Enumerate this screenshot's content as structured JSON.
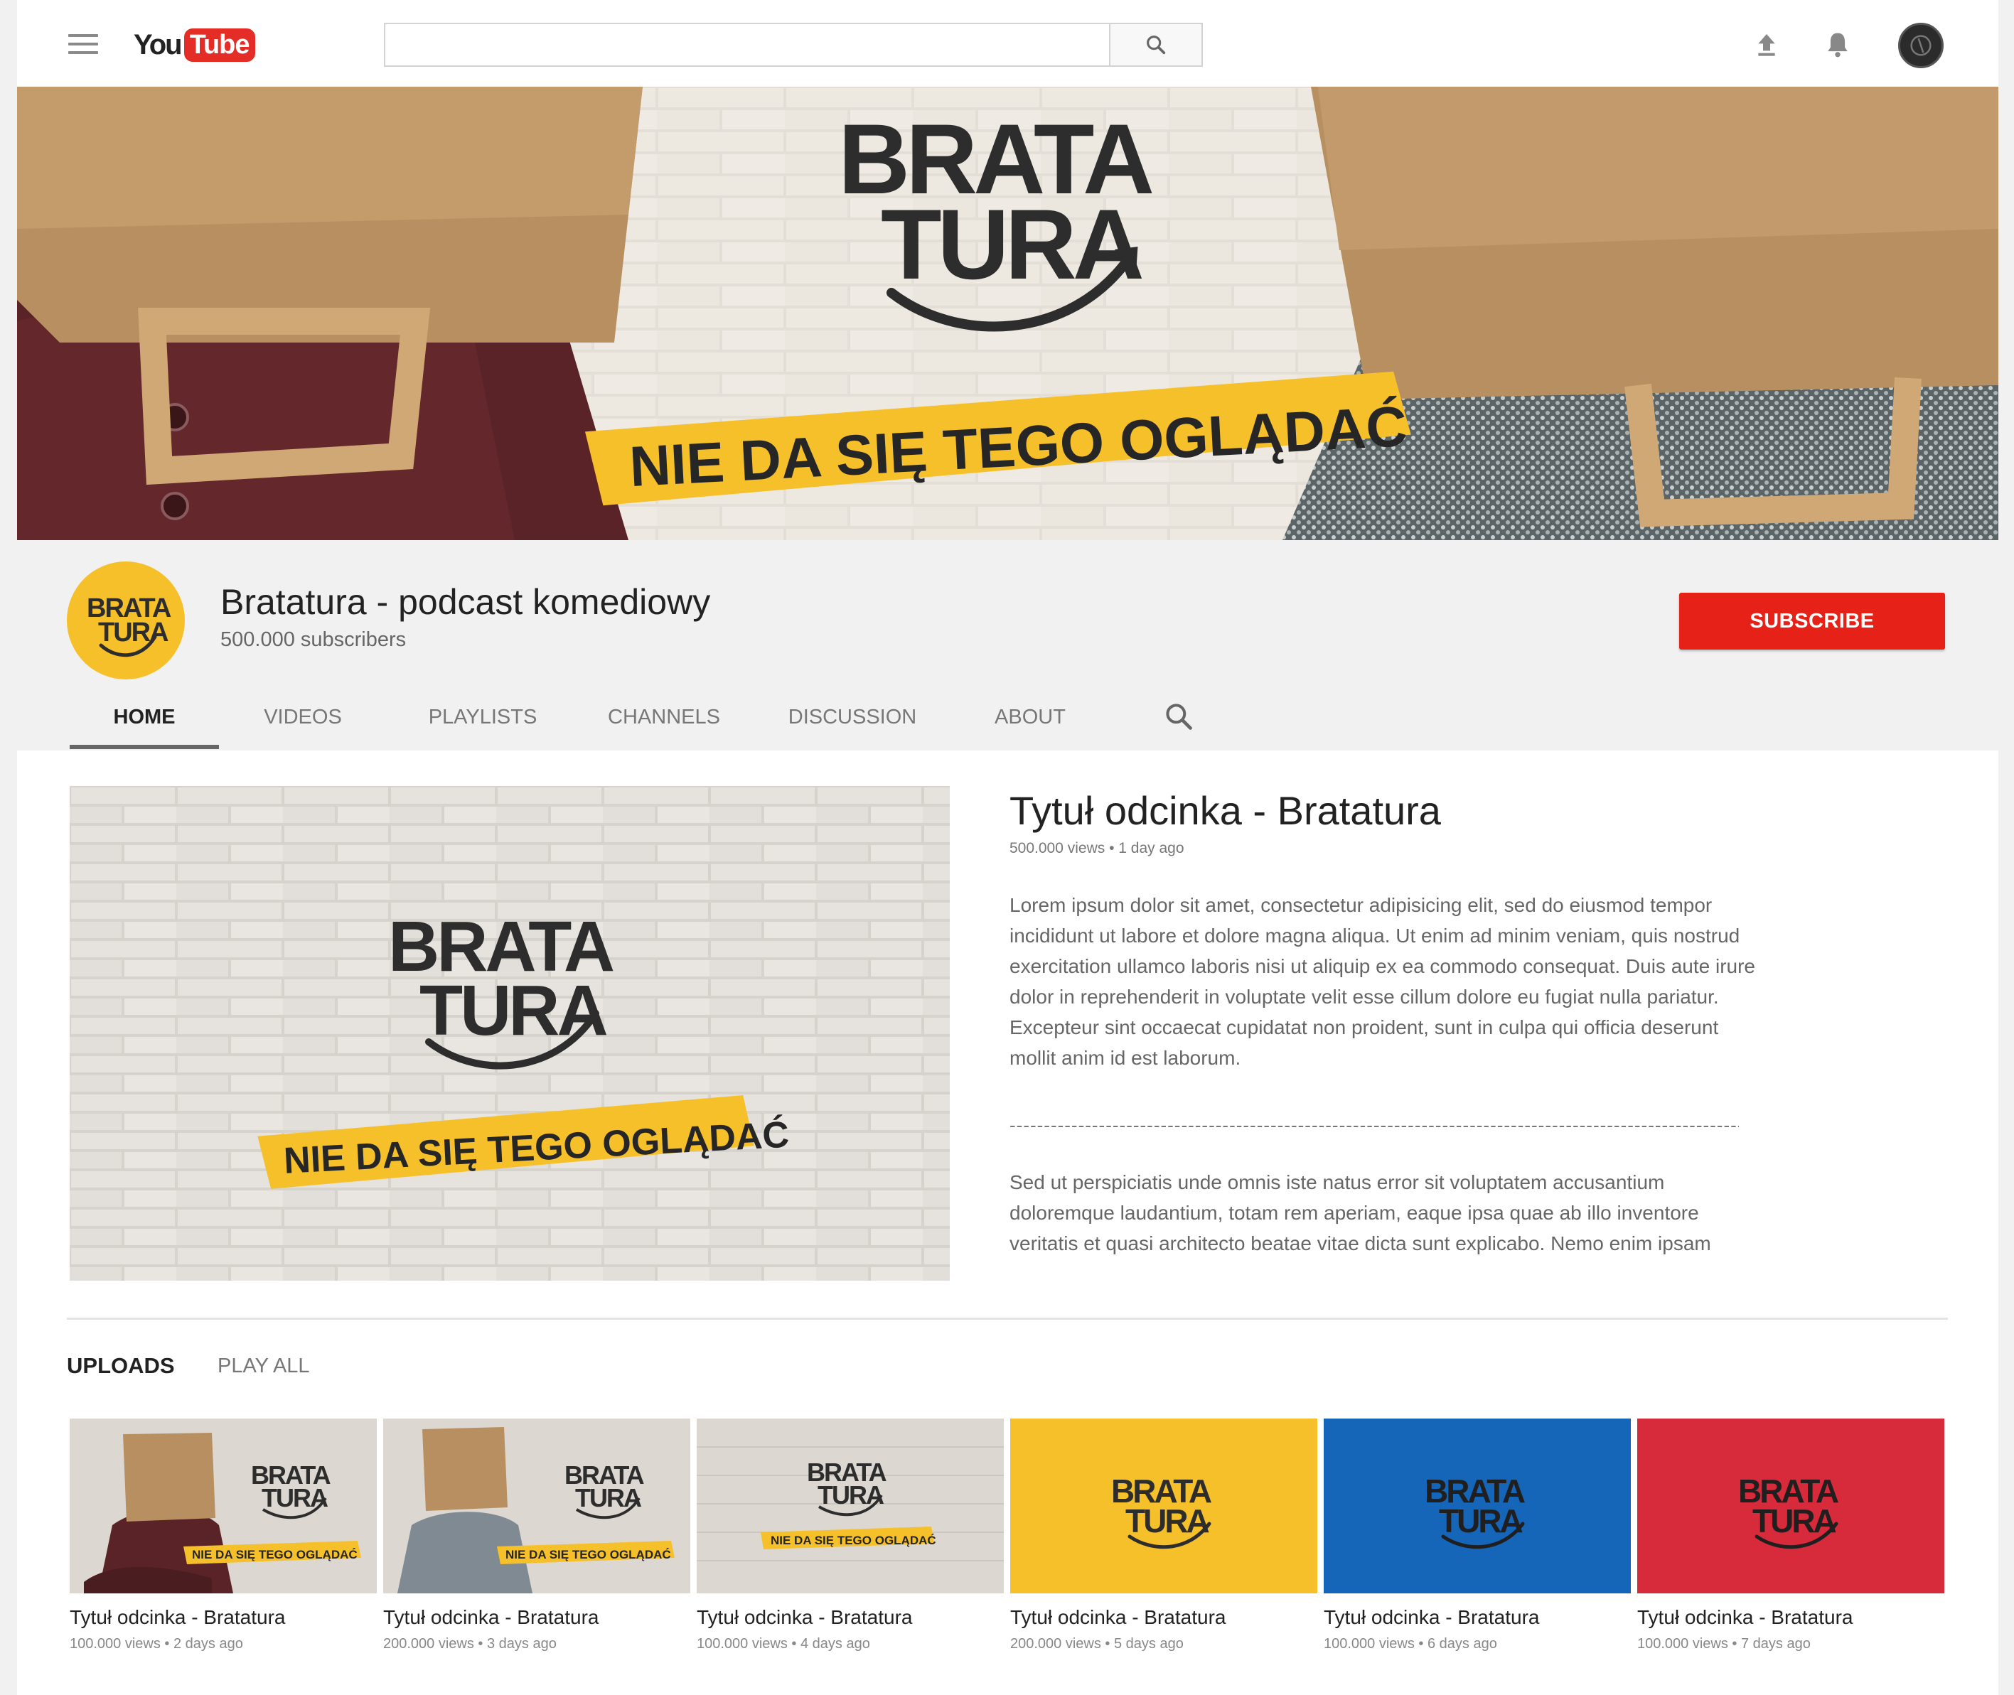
{
  "topbar": {
    "logo_you": "You",
    "logo_tube": "Tube",
    "search_placeholder": ""
  },
  "banner": {
    "logo_line1": "BRATA",
    "logo_line2": "TURA",
    "tagline": "NIE DA SIĘ TEGO OGLĄDAĆ"
  },
  "channel": {
    "title": "Bratatura - podcast komediowy",
    "subscribers": "500.000 subscribers",
    "subscribe_label": "SUBSCRIBE",
    "avatar_line1": "BRATA",
    "avatar_line2": "TURA"
  },
  "tabs": [
    {
      "label": "HOME",
      "active": true
    },
    {
      "label": "VIDEOS",
      "active": false
    },
    {
      "label": "PLAYLISTS",
      "active": false
    },
    {
      "label": "CHANNELS",
      "active": false
    },
    {
      "label": "DISCUSSION",
      "active": false
    },
    {
      "label": "ABOUT",
      "active": false
    }
  ],
  "featured": {
    "title": "Tytuł odcinka - Bratatura",
    "meta": "500.000 views • 1 day ago",
    "description": "Lorem ipsum dolor sit amet, consectetur adipisicing elit, sed do eiusmod tempor incididunt ut labore et dolore magna aliqua. Ut enim ad minim veniam, quis nostrud exercitation ullamco laboris nisi ut aliquip ex ea commodo consequat. Duis aute irure dolor in reprehenderit in voluptate velit esse cillum dolore eu fugiat nulla pariatur. Excepteur sint occaecat cupidatat non proident, sunt in culpa qui officia deserunt mollit anim id est laborum.",
    "separator": "--------------------------------------------------------------------------------------------------------------------------------",
    "description2": "Sed ut perspiciatis unde omnis iste natus error sit voluptatem accusantium doloremque laudantium, totam rem aperiam, eaque ipsa quae ab illo inventore veritatis et quasi architecto beatae vitae dicta sunt explicabo. Nemo enim ipsam",
    "thumb_line1": "BRATA",
    "thumb_line2": "TURA",
    "thumb_tagline": "NIE DA SIĘ TEGO OGLĄDAĆ"
  },
  "uploads": {
    "title": "UPLOADS",
    "play_all": "PLAY ALL",
    "thumb_line1": "BRATA",
    "thumb_line2": "TURA",
    "thumb_tagline": "NIE DA SIĘ TEGO OGLĄDAĆ",
    "items": [
      {
        "title": "Tytuł odcinka - Bratatura",
        "meta": "100.000 views • 2 days ago",
        "style": "person-red"
      },
      {
        "title": "Tytuł odcinka - Bratatura",
        "meta": "200.000 views • 3 days ago",
        "style": "person-gray"
      },
      {
        "title": "Tytuł odcinka - Bratatura",
        "meta": "100.000 views • 4 days ago",
        "style": "brick"
      },
      {
        "title": "Tytuł odcinka - Bratatura",
        "meta": "200.000 views • 5 days ago",
        "style": "yellow"
      },
      {
        "title": "Tytuł odcinka - Bratatura",
        "meta": "100.000 views • 6 days ago",
        "style": "blue"
      },
      {
        "title": "Tytuł odcinka - Bratatura",
        "meta": "100.000 views • 7 days ago",
        "style": "red"
      }
    ]
  },
  "colors": {
    "brand_yellow": "#f6c02b",
    "subscribe_red": "#e62117",
    "thumb_blue": "#1565b8",
    "thumb_red": "#d72a3a",
    "logo_dark": "#2d2d2d"
  }
}
